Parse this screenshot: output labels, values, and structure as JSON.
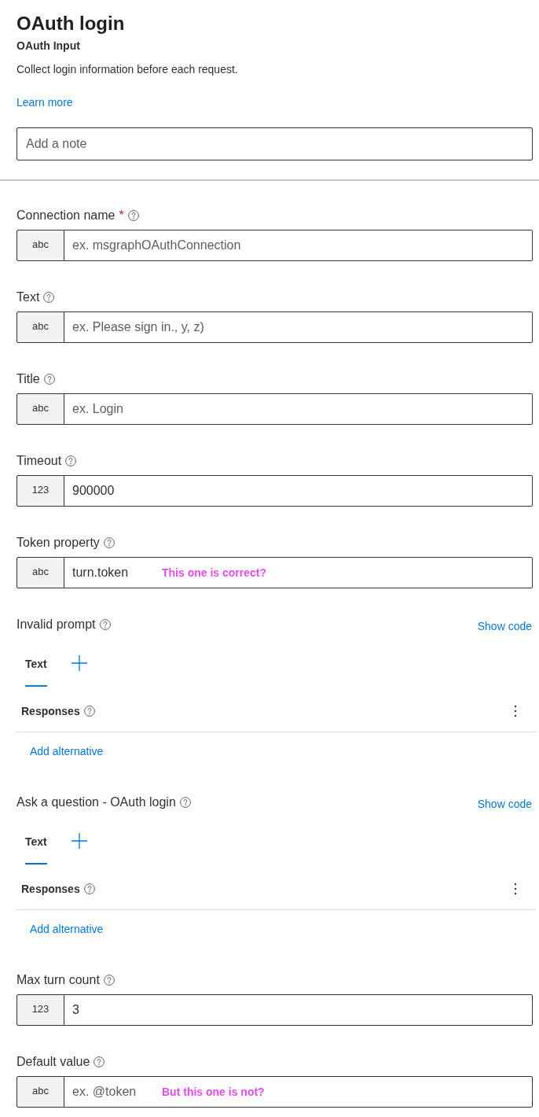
{
  "header": {
    "title": "OAuth login",
    "subtitle": "OAuth Input",
    "description": "Collect login information before each request.",
    "link": "Learn more"
  },
  "note": {
    "placeholder": "Add a note"
  },
  "form": [
    {
      "kind": "field",
      "label": "Connection name",
      "required_mark": "*",
      "badge": "abc",
      "placeholder": "ex. msgraphOAuthConnection"
    },
    {
      "kind": "field",
      "label": "Text",
      "badge": "abc",
      "placeholder": "ex. Please sign in., y, z)"
    },
    {
      "kind": "field",
      "label": "Title",
      "badge": "abc",
      "placeholder": "ex. Login"
    },
    {
      "kind": "field",
      "label": "Timeout",
      "badge": "123",
      "value": "900000"
    },
    {
      "kind": "field",
      "label": "Token property",
      "badge": "abc",
      "value": "turn.token",
      "annotation": "This one is correct?"
    },
    {
      "kind": "prompt",
      "label": "Invalid prompt",
      "link": "Show code",
      "tabs": [
        {
          "label": "Text",
          "selected": true
        }
      ],
      "responses": "Responses",
      "add_link": "Add alternative"
    },
    {
      "kind": "prompt",
      "label": "Ask a question - OAuth login",
      "link": "Show code",
      "tabs": [
        {
          "label": "Text",
          "selected": true
        }
      ],
      "responses": "Responses",
      "add_link": "Add alternative"
    },
    {
      "kind": "field",
      "label": "Max turn count",
      "badge": "123",
      "value": "3"
    },
    {
      "kind": "field",
      "label": "Default value",
      "badge": "abc",
      "placeholder": "ex. @token",
      "annotation": "But this one is not?"
    }
  ]
}
